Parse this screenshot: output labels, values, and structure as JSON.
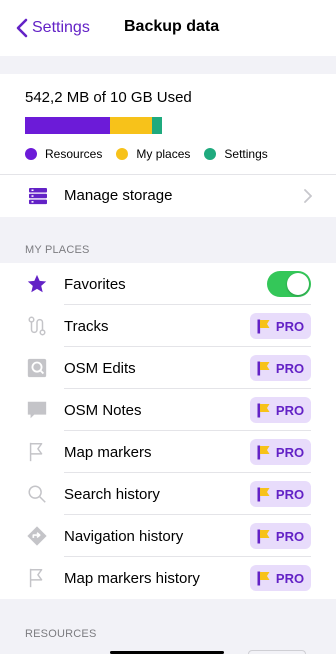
{
  "navbar": {
    "back_label": "Settings",
    "title": "Backup data"
  },
  "usage": {
    "text": "542,2 MB of 10 GB Used",
    "segments": [
      {
        "name": "Resources",
        "fraction": 0.62,
        "color": "#6c1bd8"
      },
      {
        "name": "My places",
        "fraction": 0.31,
        "color": "#f7c21a"
      },
      {
        "name": "Settings",
        "fraction": 0.07,
        "color": "#1faa7e"
      }
    ],
    "legend": [
      {
        "label": "Resources",
        "color": "#6c1bd8"
      },
      {
        "label": "My places",
        "color": "#f7c21a"
      },
      {
        "label": "Settings",
        "color": "#1faa7e"
      }
    ]
  },
  "manage_storage": {
    "label": "Manage storage",
    "icon": "storage-list-icon"
  },
  "sections": {
    "my_places": "MY PLACES",
    "resources": "RESOURCES"
  },
  "my_places_items": [
    {
      "label": "Favorites",
      "icon": "star-icon",
      "control": "toggle",
      "toggle_on": true
    },
    {
      "label": "Tracks",
      "icon": "tracks-icon",
      "control": "pro"
    },
    {
      "label": "OSM Edits",
      "icon": "osm-edits-icon",
      "control": "pro"
    },
    {
      "label": "OSM Notes",
      "icon": "osm-notes-icon",
      "control": "pro"
    },
    {
      "label": "Map markers",
      "icon": "flag-icon",
      "control": "pro"
    },
    {
      "label": "Search history",
      "icon": "search-icon",
      "control": "pro"
    },
    {
      "label": "Navigation history",
      "icon": "navigation-icon",
      "control": "pro"
    },
    {
      "label": "Map markers history",
      "icon": "flag-icon",
      "control": "pro"
    }
  ],
  "pro_badge": {
    "label": "PRO",
    "flag_color": "#f7c21a",
    "text_color": "#6322c6",
    "bg_color": "#e8dcfb"
  },
  "colors": {
    "accent": "#6322c6",
    "toggle_on": "#34c759"
  }
}
